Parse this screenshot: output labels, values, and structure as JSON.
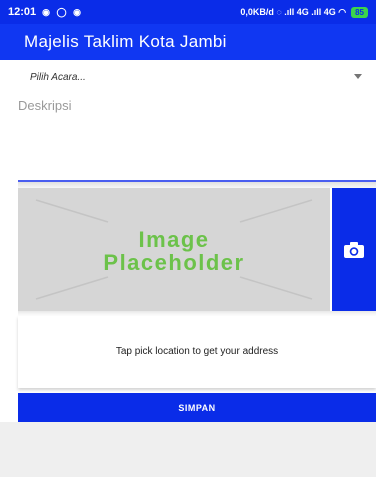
{
  "status_bar": {
    "time": "12:01",
    "left_icons": "◉ ◯ ◉",
    "network": "0,0KB/d ◌ .ıll 4G .ıll 4G ◠",
    "battery": "85"
  },
  "app_bar": {
    "title": "Majelis Taklim Kota Jambi"
  },
  "form": {
    "event_select": {
      "placeholder": "Pilih Acara..."
    },
    "description": {
      "placeholder": "Deskripsi"
    },
    "image": {
      "placeholder_line1": "Image",
      "placeholder_line2": "Placeholder"
    },
    "location": {
      "text": "Tap pick location to get your address"
    },
    "save_label": "SIMPAN"
  },
  "colors": {
    "primary": "#1037f2",
    "accent_green": "#6cc24a",
    "placeholder_bg": "#d6d6d6"
  },
  "icons": {
    "camera": "camera-icon",
    "dropdown": "caret-down-icon"
  }
}
